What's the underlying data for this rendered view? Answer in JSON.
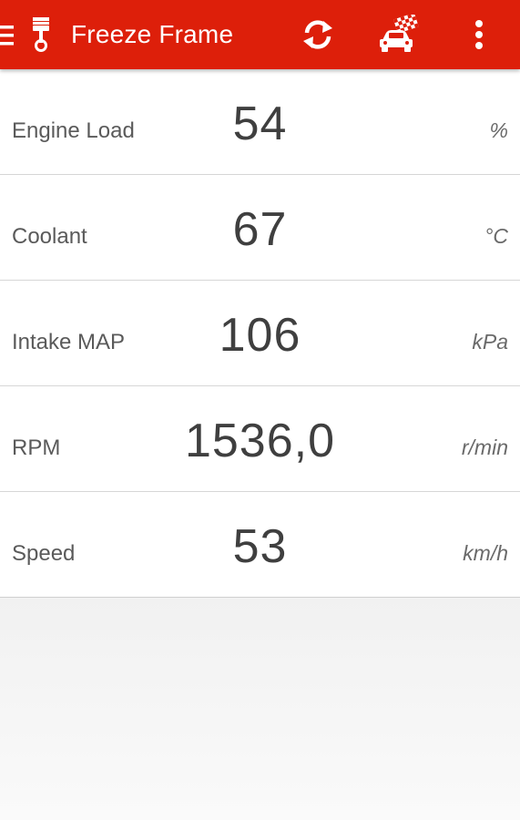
{
  "appbar": {
    "title": "Freeze Frame",
    "background_color": "#dd1f0a",
    "icons": {
      "menu": "menu-icon",
      "app_logo": "piston-icon",
      "refresh": "refresh-icon",
      "race": "race-car-flag-icon",
      "overflow": "more-vert-icon"
    }
  },
  "rows": [
    {
      "label": "Engine Load",
      "value": "54",
      "unit": "%"
    },
    {
      "label": "Coolant",
      "value": "67",
      "unit": "°C"
    },
    {
      "label": "Intake MAP",
      "value": "106",
      "unit": "kPa"
    },
    {
      "label": "RPM",
      "value": "1536,0",
      "unit": "r/min"
    },
    {
      "label": "Speed",
      "value": "53",
      "unit": "km/h"
    }
  ]
}
